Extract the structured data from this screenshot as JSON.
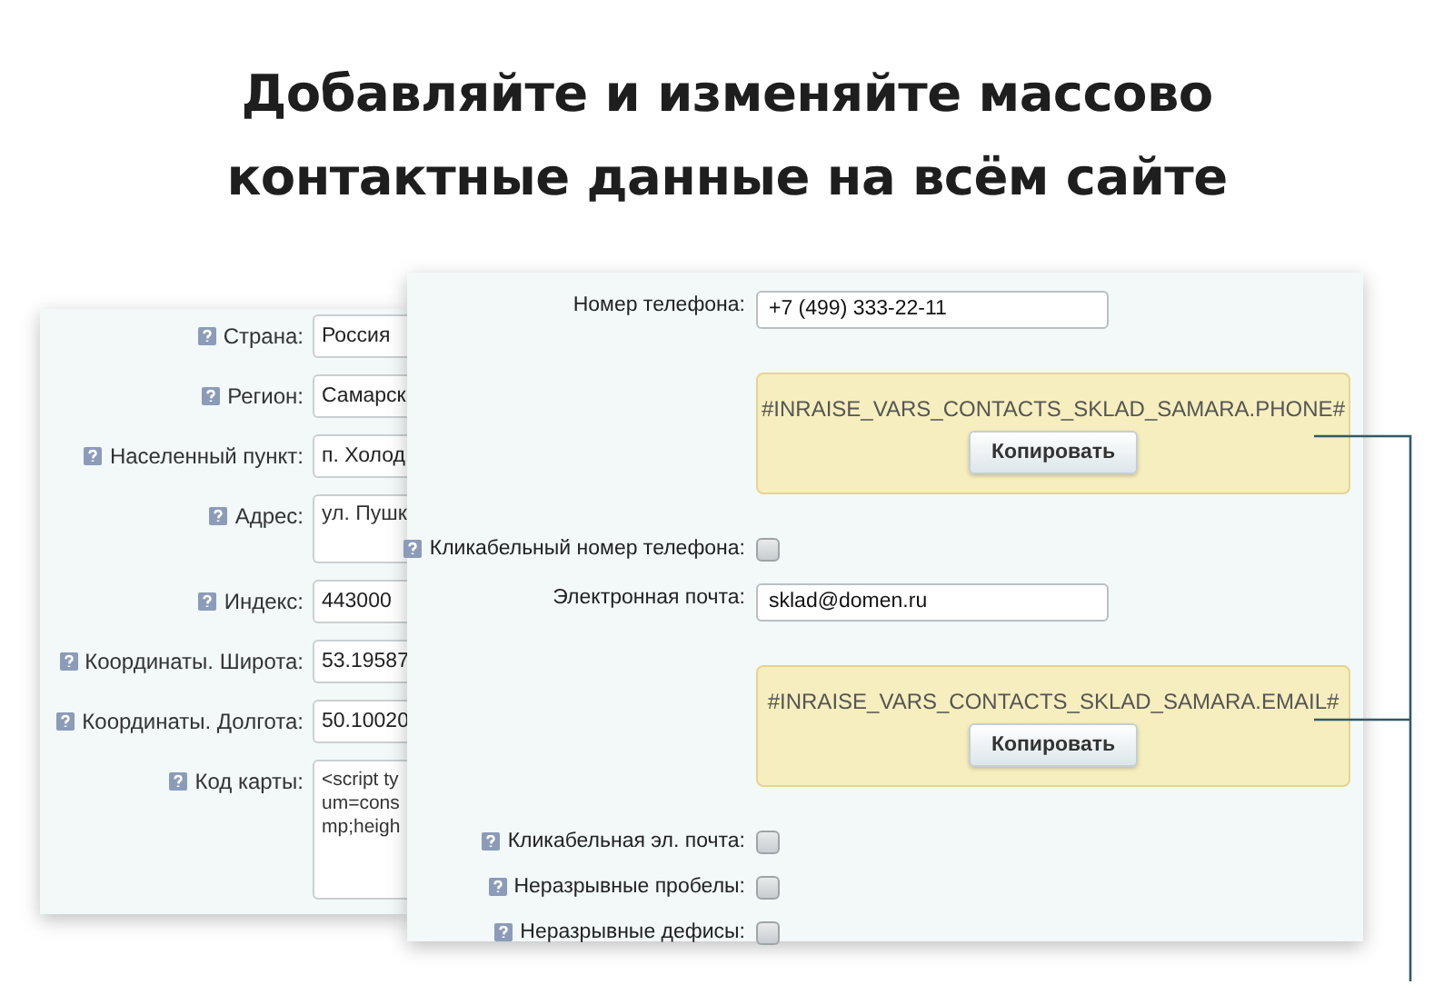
{
  "heading": [
    "Добавляйте и изменяйте массово",
    "контактные данные на всём сайте"
  ],
  "back_form": {
    "fields": [
      {
        "kind": "input",
        "label": "Страна:",
        "help": true,
        "value": "Россия"
      },
      {
        "kind": "input",
        "label": "Регион:",
        "help": true,
        "value": "Самарск"
      },
      {
        "kind": "input",
        "label": "Населенный пункт:",
        "help": true,
        "value": "п. Холод"
      },
      {
        "kind": "textarea",
        "label": "Адрес:",
        "help": true,
        "lines": [
          "ул. Пушк"
        ]
      },
      {
        "kind": "input",
        "label": "Индекс:",
        "help": true,
        "value": "443000"
      },
      {
        "kind": "input",
        "label": "Координаты. Широта:",
        "help": true,
        "value": "53.19587"
      },
      {
        "kind": "input",
        "label": "Координаты. Долгота:",
        "help": true,
        "value": "50.10020"
      },
      {
        "kind": "textarea",
        "label": "Код карты:",
        "help": true,
        "lines": [
          "<script ty",
          "um=cons",
          "mp;heigh"
        ]
      }
    ]
  },
  "front_form": {
    "rows": [
      {
        "kind": "input",
        "label": "Номер телефона:",
        "help": false,
        "value": "+7 (499) 333-22-11"
      },
      {
        "kind": "variable",
        "code": "#INRAISE_VARS_CONTACTS_SKLAD_SAMARA.PHONE#",
        "button": "Копировать"
      },
      {
        "kind": "checkbox",
        "label": "Кликабельный номер телефона:",
        "help": true,
        "checked": false
      },
      {
        "kind": "input",
        "label": "Электронная почта:",
        "help": false,
        "value": "sklad@domen.ru"
      },
      {
        "kind": "variable",
        "code": "#INRAISE_VARS_CONTACTS_SKLAD_SAMARA.EMAIL#",
        "button": "Копировать"
      },
      {
        "kind": "checkbox",
        "label": "Кликабельная эл. почта:",
        "help": true,
        "checked": false
      },
      {
        "kind": "checkbox",
        "label": "Неразрывные пробелы:",
        "help": true,
        "checked": false
      },
      {
        "kind": "checkbox",
        "label": "Неразрывные дефисы:",
        "help": true,
        "checked": false
      }
    ]
  }
}
